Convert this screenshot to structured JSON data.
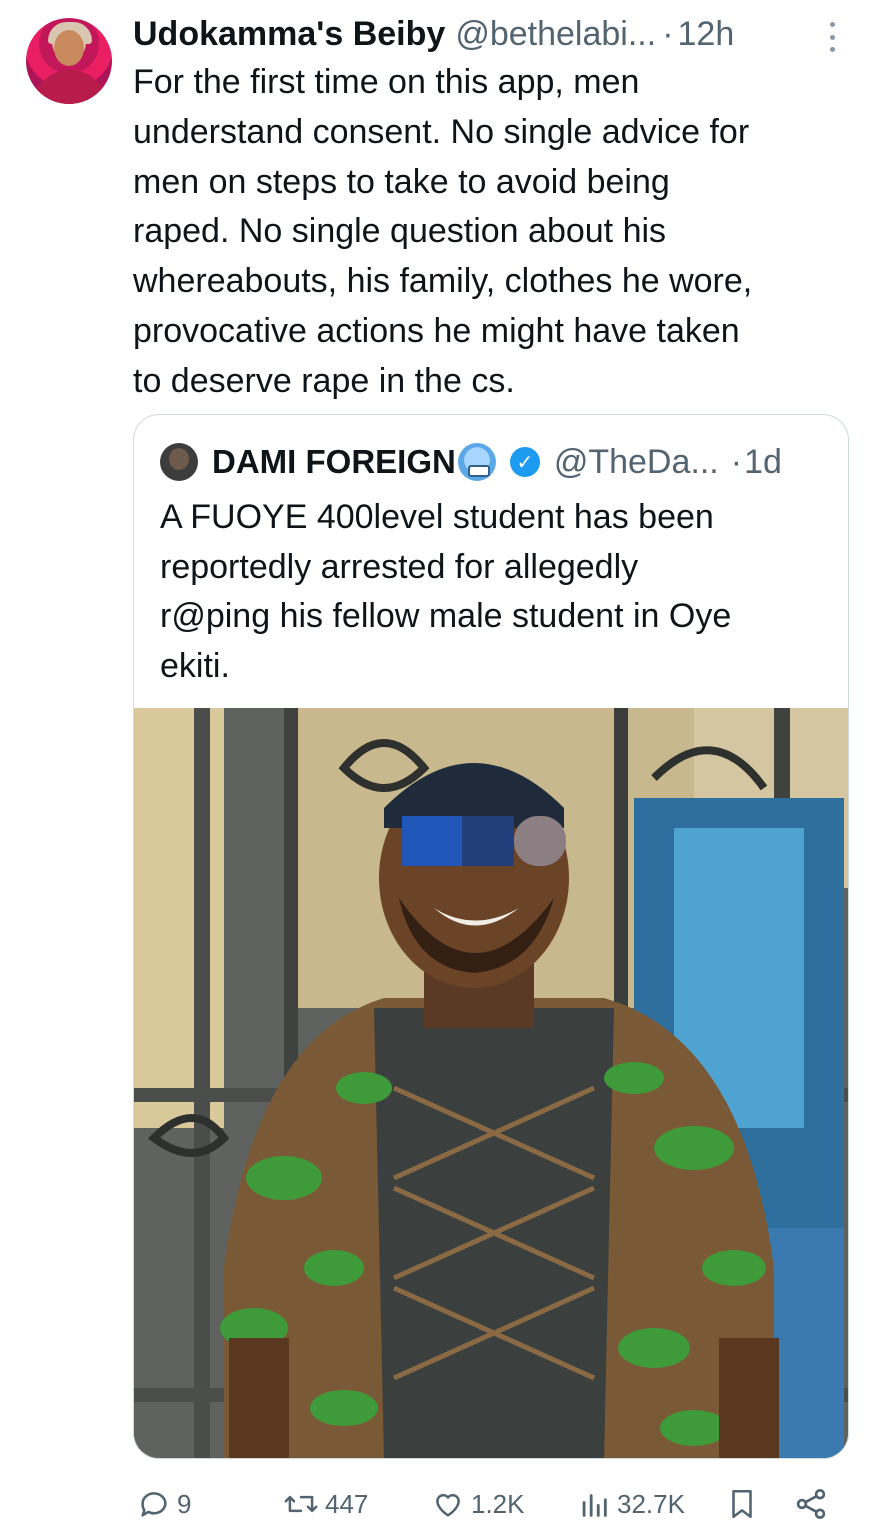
{
  "tweet": {
    "display_name": "Udokamma's Beiby",
    "handle": "@bethelabi...",
    "separator": "·",
    "time": "12h",
    "text_lines": [
      "For the first time on this app, men",
      "understand consent. No single advice for",
      "men on steps to take to avoid being",
      "raped. No single question about his",
      "whereabouts, his family, clothes he wore,",
      "provocative actions he might have taken",
      "to deserve rape in the cs."
    ]
  },
  "quote": {
    "display_name": "DAMI FOREIGN",
    "emoji": "cold-face-emoji",
    "verified": true,
    "handle": "@TheDa...",
    "separator": "·",
    "time": "1d",
    "text_lines": [
      "A FUOYE 400level student has been",
      "reportedly arrested for allegedly",
      "r@ping his fellow male student in Oye",
      "ekiti."
    ],
    "media": "photo of a smiling man in a green patterned native outfit with face partly blurred"
  },
  "actions": {
    "replies": "9",
    "reposts": "447",
    "likes": "1.2K",
    "views": "32.7K"
  },
  "colors": {
    "text": "#0f1419",
    "secondary": "#536471",
    "verified": "#1d9bf0",
    "border": "#cfd9de"
  }
}
